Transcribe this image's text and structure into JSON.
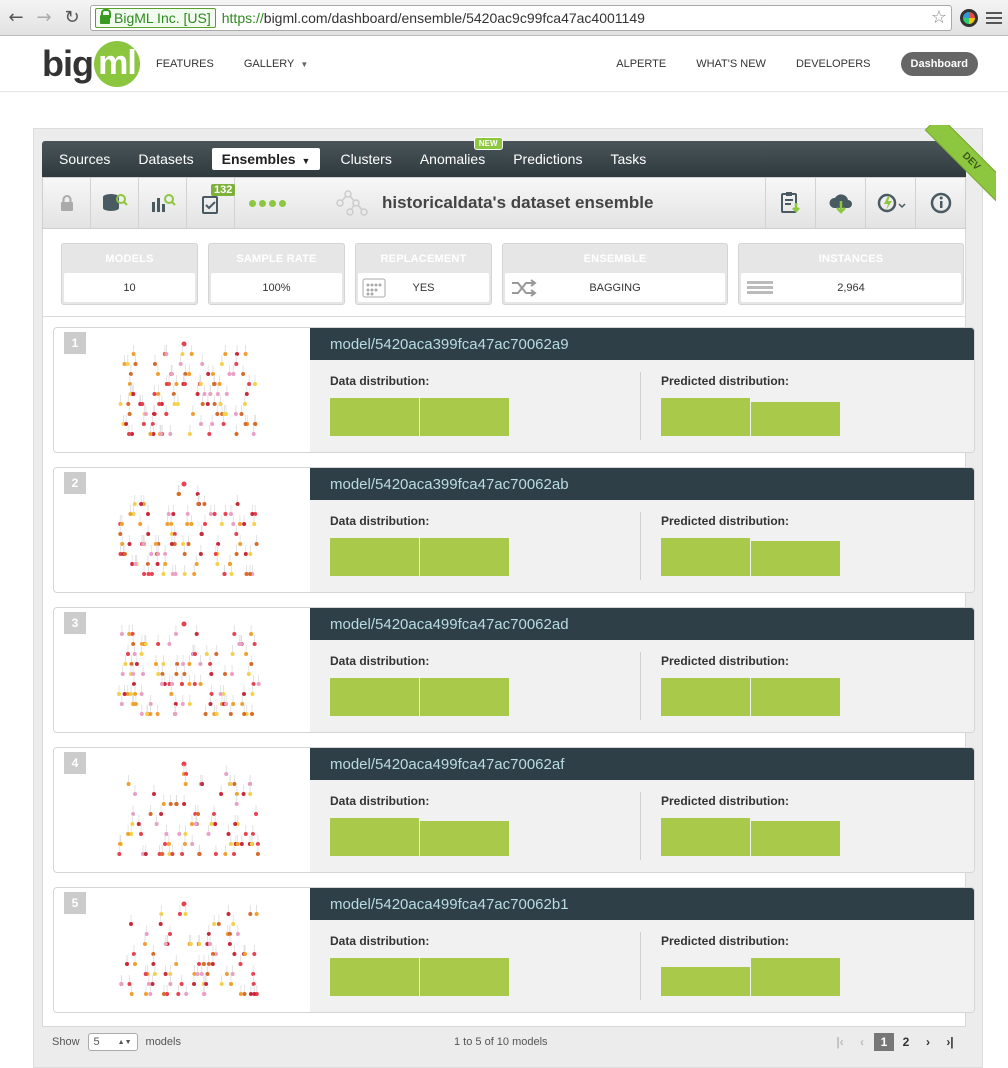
{
  "browser": {
    "ev_name": "BigML Inc. [US]",
    "url_scheme": "https://",
    "url_rest": "bigml.com/dashboard/ensemble/5420ac9c99fca47ac4001149"
  },
  "site": {
    "logo_a": "big",
    "logo_b": "ml",
    "features": "FEATURES",
    "gallery": "GALLERY",
    "user": "ALPERTE",
    "whats_new": "WHAT'S NEW",
    "developers": "DEVELOPERS",
    "dashboard": "Dashboard"
  },
  "tabs": {
    "sources": "Sources",
    "datasets": "Datasets",
    "ensembles": "Ensembles",
    "clusters": "Clusters",
    "anomalies": "Anomalies",
    "new_badge": "NEW",
    "predictions": "Predictions",
    "tasks": "Tasks",
    "dev_ribbon": "DEV"
  },
  "toolbar": {
    "task_count": "132",
    "title": "historicaldata's dataset ensemble"
  },
  "stats": [
    {
      "label": "MODELS",
      "value": "10",
      "color": "#c8c8c8"
    },
    {
      "label": "SAMPLE RATE",
      "value": "100%",
      "color": "#c8c8c8"
    },
    {
      "label": "REPLACEMENT",
      "value": "YES",
      "color": "#c8c8c8"
    },
    {
      "label": "ENSEMBLE",
      "value": "BAGGING",
      "color": "#c8c8c8"
    },
    {
      "label": "INSTANCES",
      "value": "2,964",
      "color": "#c8c8c8"
    }
  ],
  "models": [
    {
      "num": "1",
      "id": "model/5420aca399fca47ac70062a9",
      "data_label": "Data distribution:",
      "pred_label": "Predicted distribution:",
      "data_dist": [
        0.5,
        0.5
      ],
      "pred_dist": [
        0.53,
        0.47
      ]
    },
    {
      "num": "2",
      "id": "model/5420aca399fca47ac70062ab",
      "data_label": "Data distribution:",
      "pred_label": "Predicted distribution:",
      "data_dist": [
        0.5,
        0.5
      ],
      "pred_dist": [
        0.52,
        0.48
      ]
    },
    {
      "num": "3",
      "id": "model/5420aca499fca47ac70062ad",
      "data_label": "Data distribution:",
      "pred_label": "Predicted distribution:",
      "data_dist": [
        0.5,
        0.5
      ],
      "pred_dist": [
        0.5,
        0.5
      ]
    },
    {
      "num": "4",
      "id": "model/5420aca499fca47ac70062af",
      "data_label": "Data distribution:",
      "pred_label": "Predicted distribution:",
      "data_dist": [
        0.52,
        0.48
      ],
      "pred_dist": [
        0.52,
        0.48
      ]
    },
    {
      "num": "5",
      "id": "model/5420aca499fca47ac70062b1",
      "data_label": "Data distribution:",
      "pred_label": "Predicted distribution:",
      "data_dist": [
        0.5,
        0.5
      ],
      "pred_dist": [
        0.43,
        0.57
      ]
    }
  ],
  "footer": {
    "show": "Show",
    "per_page": "5",
    "models_word": "models",
    "range": "1 to 5 of 10 models",
    "pages": [
      "1",
      "2"
    ]
  },
  "colors": {
    "accent": "#8dc63f",
    "bar": "#a9c94b",
    "header_dark": "#2f3f47"
  }
}
